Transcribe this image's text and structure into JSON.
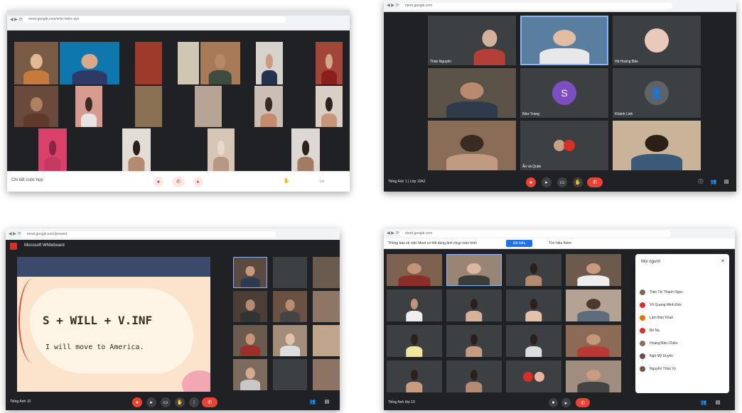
{
  "colors": {
    "meet_bg": "#202124",
    "tile_bg": "#3c4043",
    "end_call": "#ea4335",
    "accent": "#8ab4f8"
  },
  "panel_tl": {
    "url": "meet.google.com/xmo-bnhx-ayo",
    "bottom_left": "Chi tiết cuộc họp",
    "icons": [
      "mic-icon",
      "camera-icon",
      "present-icon",
      "hand-icon",
      "chat-icon"
    ]
  },
  "panel_tr": {
    "url": "meet.google.com",
    "names": [
      "Thảo Nguyên",
      "",
      "Hà Hoàng Bảo",
      "",
      "Như Trang",
      "Khánh Linh",
      "",
      "Ân và Quân",
      ""
    ],
    "avatar_letter": "S",
    "bottom_left": "Tiếng Anh 1 | Lớp 10A2"
  },
  "panel_bl": {
    "url": "meet.google.com/present",
    "tab_title": "Microsoft Whiteboard",
    "slide_title": "S + WILL + V.INF",
    "slide_example": "I will move to America.",
    "bottom_left": "Tiếng Anh 10"
  },
  "panel_br": {
    "url": "meet.google.com",
    "notice": "Thông báo về việc Meet có thể dùng ảnh chụp màn hình",
    "notice_btn": "Đã hiểu",
    "notice_link": "Tìm hiểu thêm",
    "people_title": "Mọi người",
    "people": [
      "Trần Thị Thanh Ngọc",
      "Võ Quang Minh Đức",
      "Lâm Bảo Khuê",
      "Bé Na",
      "Hoàng Bảo Chiêu",
      "Ngô Mỹ Duyên",
      "Nguyễn Thảo Vy"
    ],
    "bottom_left": "Tiếng Anh lớp 10"
  }
}
